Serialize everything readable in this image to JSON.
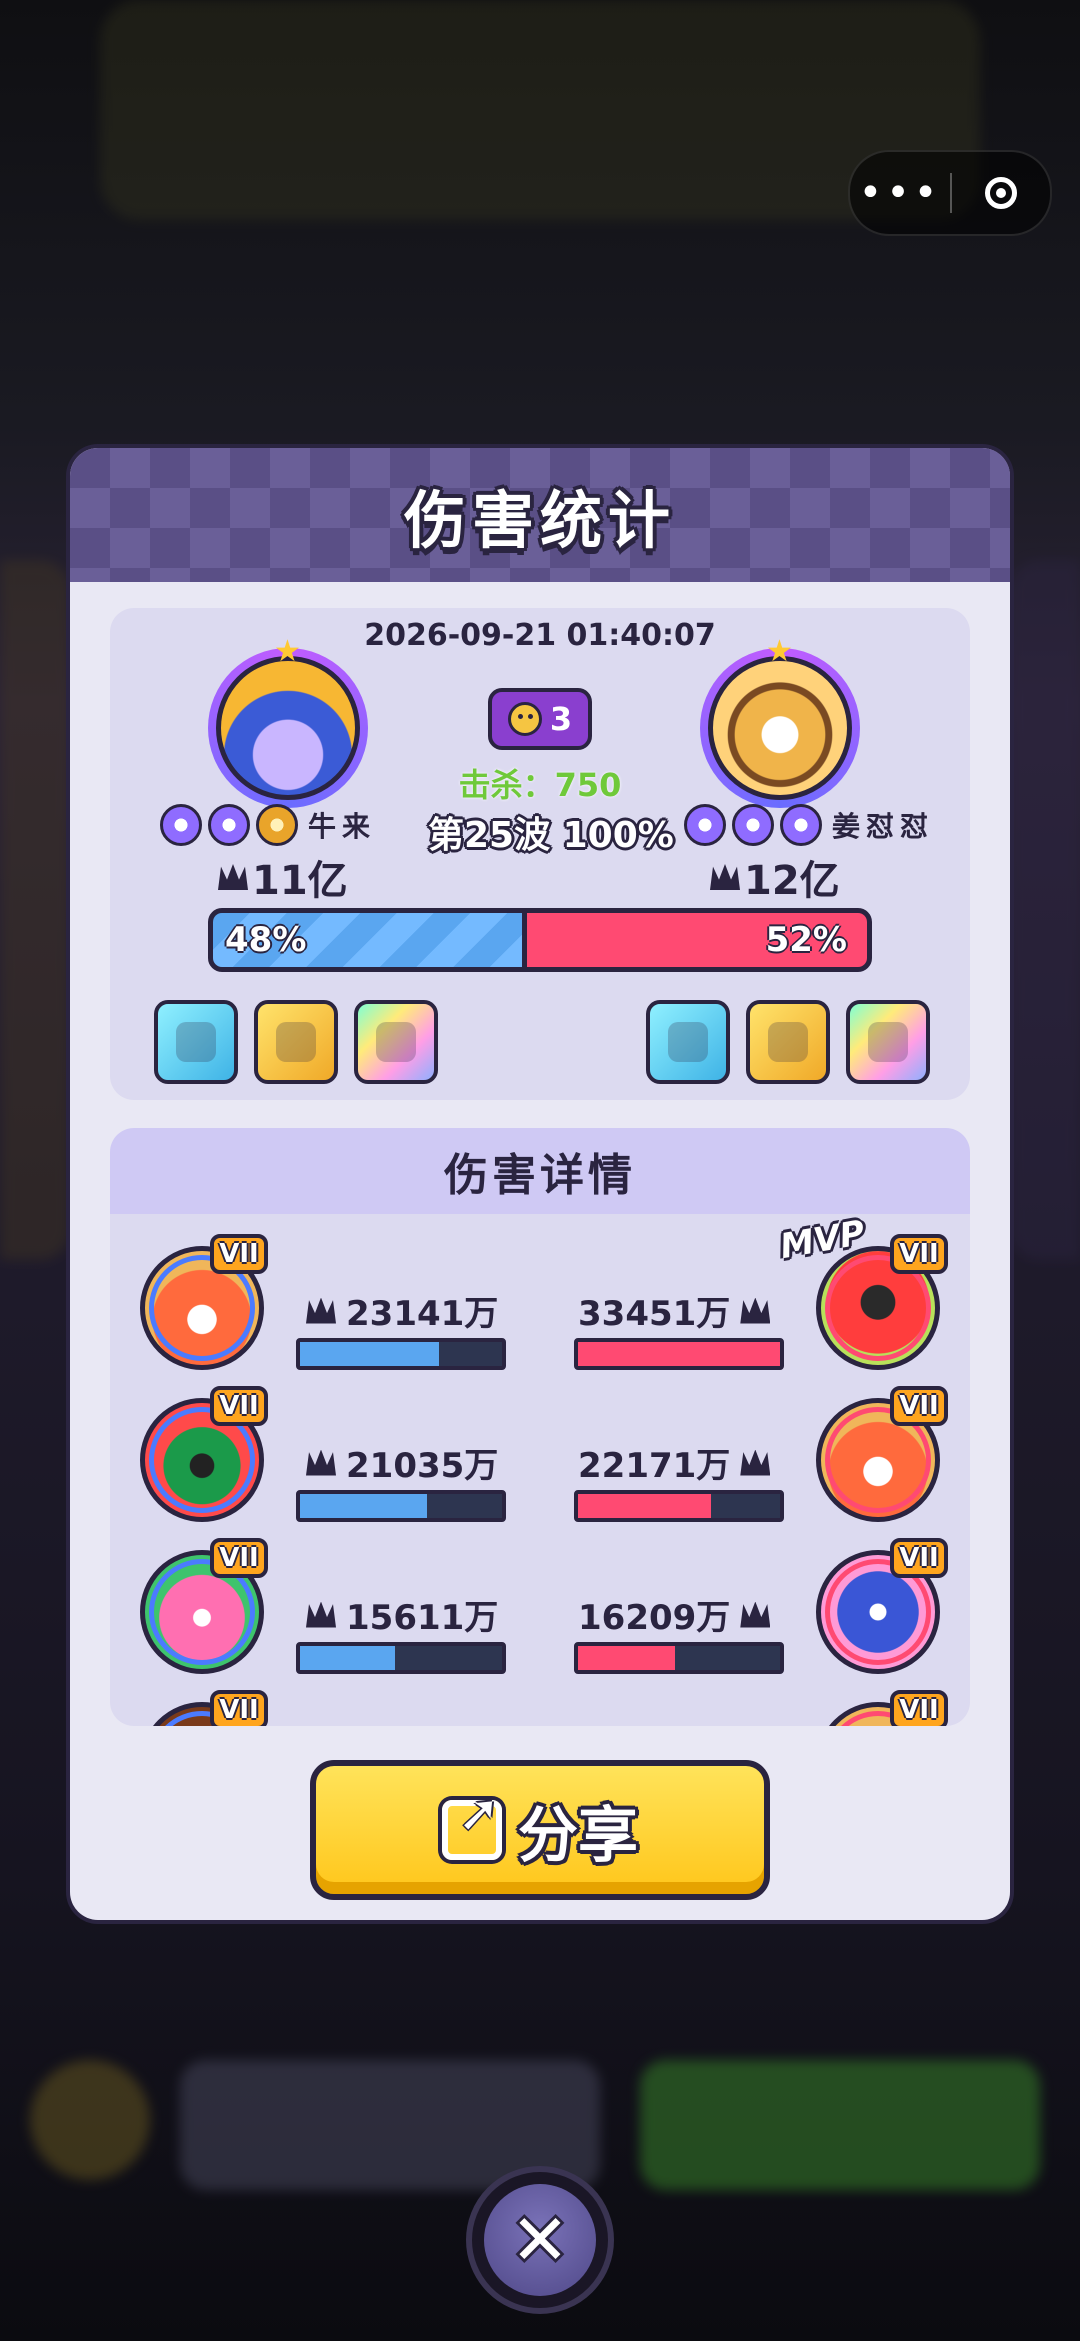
{
  "colors": {
    "accent_blue": "#5aa6f0",
    "accent_red": "#ff4a72",
    "outline": "#2a2440",
    "button_yellow": "#ffc61a",
    "kills_green": "#6fc93a"
  },
  "capsule": {
    "more_icon": "more-dots-icon",
    "close_icon": "target-icon"
  },
  "modal": {
    "title": "伤害统计",
    "datetime": "2026-09-21 01:40:07",
    "kill_badge_value": "3",
    "kills_label": "击杀：",
    "kills_value": "750",
    "wave_text": "第25波 100%",
    "left_player": {
      "name": "牛来",
      "total_damage": "11亿",
      "share_label": "48%",
      "share_value": 48
    },
    "right_player": {
      "name": "姜怼怼",
      "total_damage": "12亿",
      "share_label": "52%",
      "share_value": 52
    },
    "details_title": "伤害详情",
    "mvp_label": "MVP",
    "tier_label": "VII",
    "rows": [
      {
        "left": "23141万",
        "left_fill": 0.69,
        "right": "33451万",
        "right_fill": 1.0
      },
      {
        "left": "21035万",
        "left_fill": 0.63,
        "right": "22171万",
        "right_fill": 0.66
      },
      {
        "left": "15611万",
        "left_fill": 0.47,
        "right": "16209万",
        "right_fill": 0.48
      }
    ],
    "share_button": "分享"
  },
  "close_button_glyph": "✕"
}
